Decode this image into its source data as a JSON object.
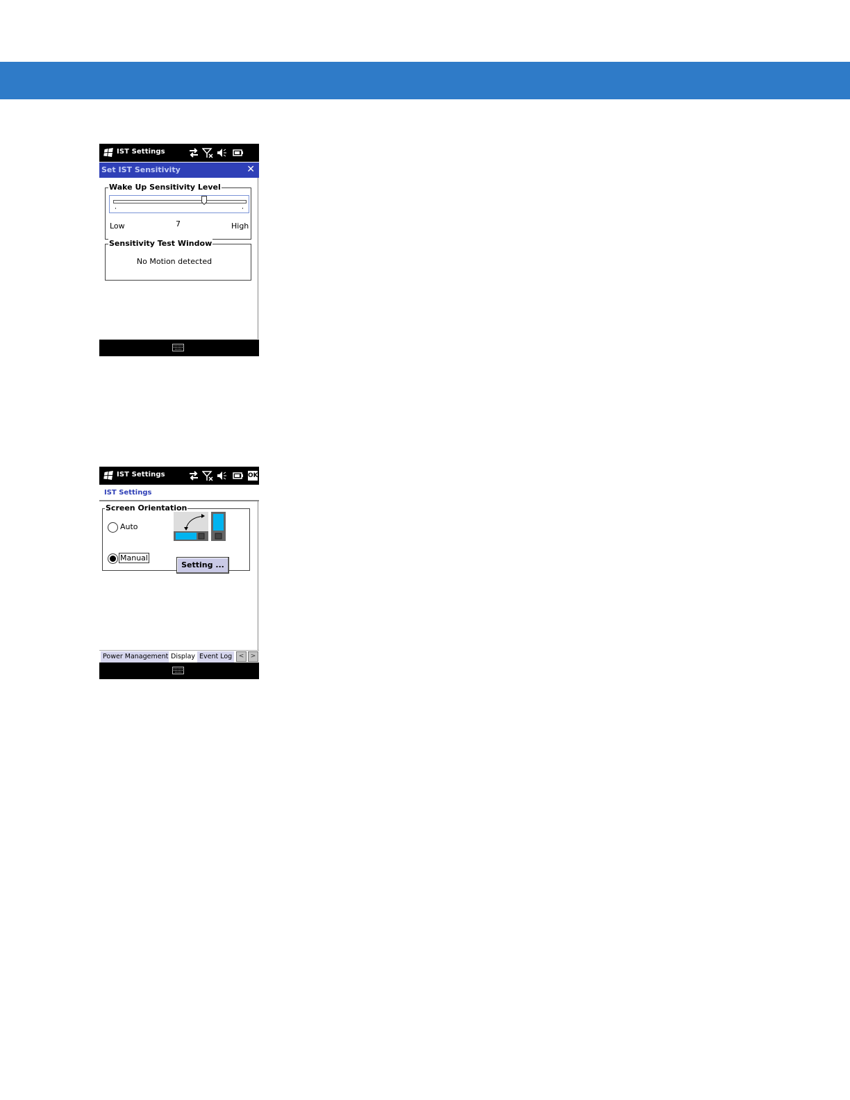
{
  "screen1": {
    "statusbar": {
      "title": "IST Settings"
    },
    "titlebar": {
      "title": "Set IST Sensitivity",
      "close_label": "✕"
    },
    "wake_group": {
      "legend": "Wake Up Sensitivity Level",
      "slider": {
        "value": 7,
        "min": 1,
        "max": 10,
        "fraction": 0.69
      },
      "low_label": "Low",
      "high_label": "High",
      "value_label": "7"
    },
    "test_group": {
      "legend": "Sensitivity Test Window",
      "message": "No Motion detected"
    }
  },
  "screen2": {
    "statusbar": {
      "title": "IST Settings",
      "ok_label": "OK"
    },
    "header": {
      "title": "IST Settings"
    },
    "orientation_group": {
      "legend": "Screen Orientation",
      "auto_label": "Auto",
      "manual_label": "Manual",
      "selected": "Manual",
      "setting_button": "Setting ..."
    },
    "tabs": [
      {
        "label": "Power Management",
        "active": false
      },
      {
        "label": "Display",
        "active": true
      },
      {
        "label": "Event Log",
        "active": false
      }
    ],
    "tab_prev": "<",
    "tab_next": ">"
  },
  "colors": {
    "banner": "#2f7bc8",
    "titlebar": "#2f40b7",
    "device_screen": "#00b4f0"
  }
}
